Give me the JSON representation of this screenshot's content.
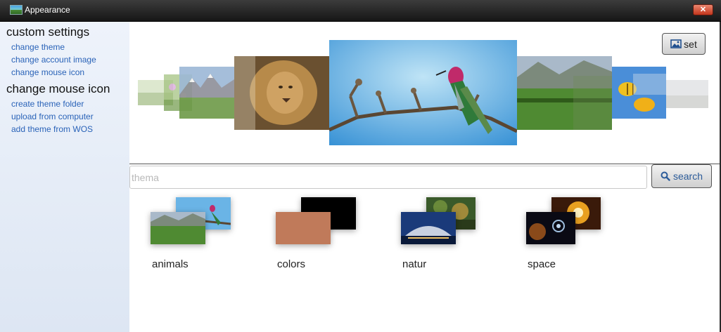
{
  "window": {
    "title": "Appearance",
    "close_glyph": "✕"
  },
  "sidebar": {
    "sections": [
      {
        "heading": "custom settings",
        "links": [
          "change theme",
          "change account image",
          "change mouse icon"
        ]
      },
      {
        "heading": "change mouse icon",
        "links": [
          "create theme folder",
          "upload from computer",
          "add theme from WOS"
        ]
      }
    ]
  },
  "toolbar": {
    "set_label": "set",
    "set_icon": "image-icon"
  },
  "carousel": {
    "items": [
      "field",
      "wildflowers",
      "mountain-meadow",
      "lion",
      "hummingbird",
      "green-valley",
      "fish",
      "gray-scene"
    ],
    "selected": "hummingbird"
  },
  "search": {
    "placeholder": "thema",
    "value": "",
    "button_label": "search",
    "button_icon": "search-icon"
  },
  "categories": [
    {
      "label": "animals"
    },
    {
      "label": "colors",
      "swatches": [
        "#000000",
        "#c07a5a"
      ]
    },
    {
      "label": "natur"
    },
    {
      "label": "space"
    }
  ],
  "colors": {
    "titlebar": "#2a2a2a",
    "sidebar_bg": "#e6edf7",
    "link": "#2a63b8",
    "close": "#c8402a"
  }
}
